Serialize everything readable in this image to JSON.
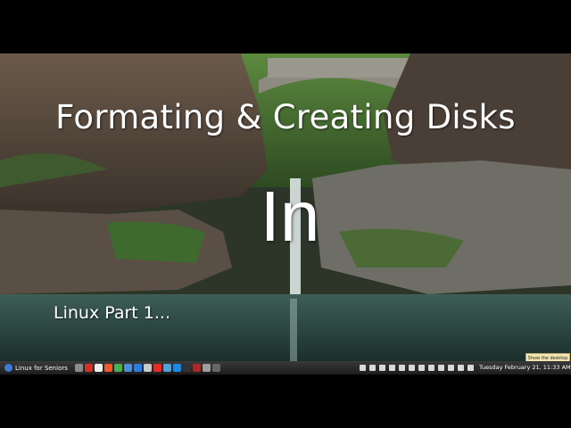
{
  "slide": {
    "title": "Formating & Creating Disks",
    "big_word": "In",
    "subtitle": "Linux Part 1..."
  },
  "tooltip": {
    "text": "Show the desktop"
  },
  "taskbar": {
    "menu_label": "Linux for Seniors",
    "launchers": [
      {
        "name": "system-icon",
        "color": "#8c8c8c"
      },
      {
        "name": "gmail-icon",
        "color": "#d93025"
      },
      {
        "name": "amazon-icon",
        "color": "#f0f0f0"
      },
      {
        "name": "brave-icon",
        "color": "#fb542b"
      },
      {
        "name": "chrome-icon",
        "color": "#4caf50"
      },
      {
        "name": "files-icon",
        "color": "#4a90d9"
      },
      {
        "name": "chromium-icon",
        "color": "#2e7de1"
      },
      {
        "name": "flag-icon",
        "color": "#c8c8c8"
      },
      {
        "name": "youtube-icon",
        "color": "#e52d27"
      },
      {
        "name": "screenshot-icon",
        "color": "#4aa3df"
      },
      {
        "name": "editor-icon",
        "color": "#1e88e5"
      },
      {
        "name": "terminal-icon",
        "color": "#333333"
      },
      {
        "name": "record-icon",
        "color": "#a52a2a"
      },
      {
        "name": "gear-icon",
        "color": "#9e9e9e"
      },
      {
        "name": "camera-icon",
        "color": "#666666"
      }
    ],
    "tray": [
      "workspace-icon",
      "mixer-icon",
      "clock-icon",
      "display-icon",
      "bluetooth-icon",
      "shield-icon",
      "star-icon",
      "printer-icon",
      "wifi-icon",
      "music-icon",
      "volume-icon",
      "battery-icon"
    ],
    "clock": "Tuesday February 21, 11:33 AM"
  }
}
